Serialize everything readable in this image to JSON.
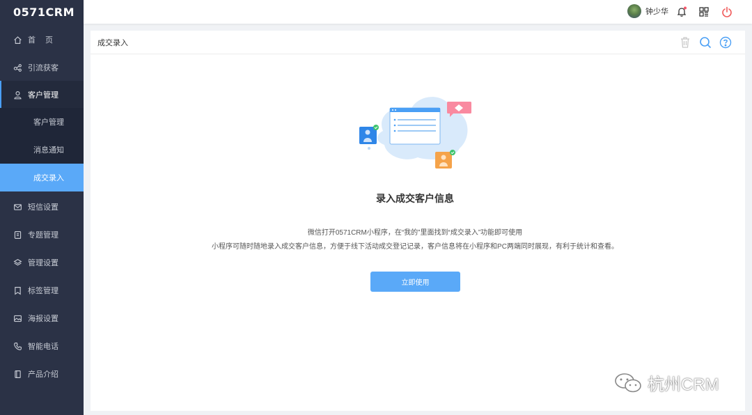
{
  "app": {
    "logo": "0571CRM"
  },
  "sidebar": {
    "items": [
      {
        "label": "首　 页",
        "icon": "home-icon"
      },
      {
        "label": "引流获客",
        "icon": "share-icon"
      },
      {
        "label": "客户管理",
        "icon": "user-icon",
        "expanded": true
      },
      {
        "label": "短信设置",
        "icon": "mail-icon"
      },
      {
        "label": "专题管理",
        "icon": "document-icon"
      },
      {
        "label": "管理设置",
        "icon": "layers-icon"
      },
      {
        "label": "标签管理",
        "icon": "tag-icon"
      },
      {
        "label": "海报设置",
        "icon": "image-icon"
      },
      {
        "label": "智能电话",
        "icon": "phone-icon"
      },
      {
        "label": "产品介绍",
        "icon": "book-icon"
      }
    ],
    "submenu": [
      {
        "label": "客户管理"
      },
      {
        "label": "消息通知"
      },
      {
        "label": "成交录入",
        "active": true
      }
    ]
  },
  "header": {
    "user_name": "钟少华",
    "notification_dot": true
  },
  "page": {
    "title": "成交录入",
    "heading": "录入成交客户信息",
    "desc_line1": "微信打开0571CRM小程序，在“我的”里面找到“成交录入”功能即可使用",
    "desc_line2": "小程序可随时随地录入成交客户信息，方便于线下活动成交登记记录，客户信息将在小程序和PC两端同时展现，有利于统计和查看。",
    "button_label": "立即使用"
  },
  "watermark": {
    "text": "杭州CRM"
  },
  "colors": {
    "sidebar_bg": "#2b3246",
    "accent": "#5aa9f8",
    "power": "#f05a5a",
    "badge": "#f5576c"
  }
}
